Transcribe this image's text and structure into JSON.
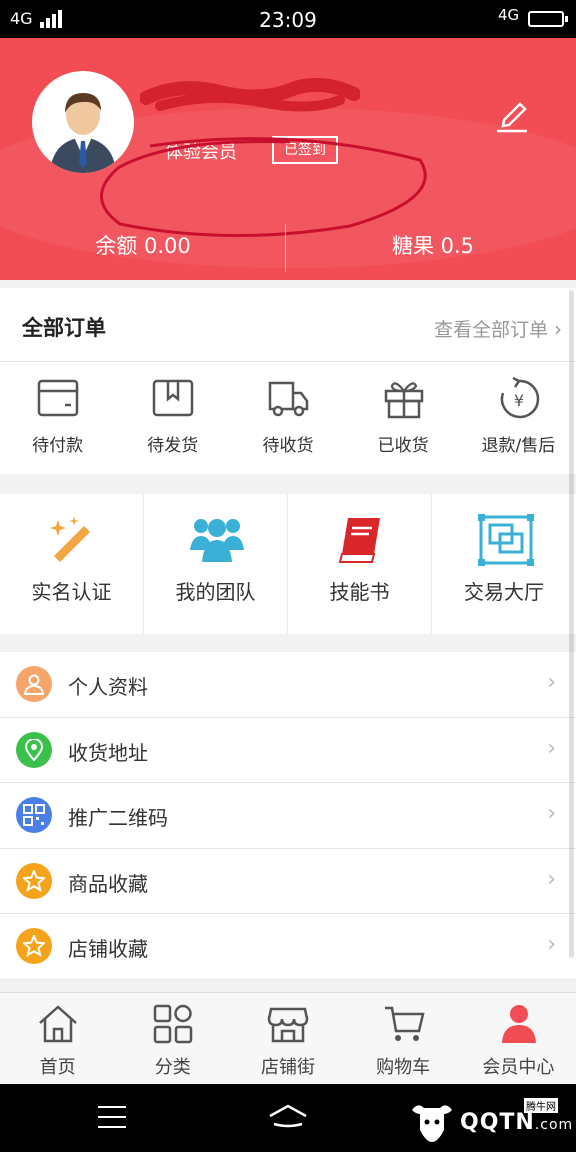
{
  "status_bar": {
    "signal_left": "4G",
    "time": "23:09",
    "signal_right": "4G"
  },
  "header": {
    "member_level": "体验会员",
    "checkin": "已签到",
    "balance": "余额 0.00",
    "candy": "糖果 0.5",
    "colors": {
      "background": "#f24d55",
      "annotation": "#c8102e"
    }
  },
  "orders": {
    "title": "全部订单",
    "view_all": "查看全部订单",
    "items": [
      {
        "label": "待付款",
        "icon": "wallet-icon"
      },
      {
        "label": "待发货",
        "icon": "box-icon"
      },
      {
        "label": "待收货",
        "icon": "truck-icon"
      },
      {
        "label": "已收货",
        "icon": "gift-icon"
      },
      {
        "label": "退款/售后",
        "icon": "refund-yen-icon"
      }
    ]
  },
  "quick": [
    {
      "label": "实名认证",
      "icon": "magic-wand-icon",
      "color": "#f2a541"
    },
    {
      "label": "我的团队",
      "icon": "team-icon",
      "color": "#3ab0d6"
    },
    {
      "label": "技能书",
      "icon": "book-icon",
      "color": "#d9262b"
    },
    {
      "label": "交易大厅",
      "icon": "trading-hall-icon",
      "color": "#3ab0d6"
    }
  ],
  "menu": [
    {
      "label": "个人资料",
      "icon": "person-icon",
      "color": "#f5a46a"
    },
    {
      "label": "收货地址",
      "icon": "location-pin-icon",
      "color": "#3cc04c"
    },
    {
      "label": "推广二维码",
      "icon": "qr-code-icon",
      "color": "#4a7fe5"
    },
    {
      "label": "商品收藏",
      "icon": "star-icon",
      "color": "#f5a31a"
    },
    {
      "label": "店铺收藏",
      "icon": "star-icon",
      "color": "#f5a31a"
    }
  ],
  "tabs": [
    {
      "label": "首页",
      "icon": "home-icon"
    },
    {
      "label": "分类",
      "icon": "category-icon"
    },
    {
      "label": "店铺街",
      "icon": "store-icon"
    },
    {
      "label": "购物车",
      "icon": "cart-icon"
    },
    {
      "label": "会员中心",
      "icon": "member-icon",
      "active": true
    }
  ],
  "watermark": {
    "text": "QQTN",
    "suffix": ".com",
    "badge": "腾牛网"
  }
}
